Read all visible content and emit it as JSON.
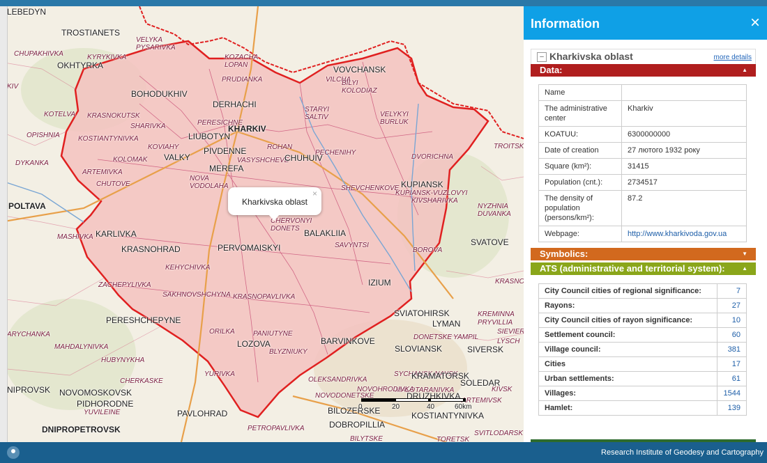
{
  "map": {
    "popup_label": "Kharkivska oblast",
    "popup_close": "×",
    "scale_labels": [
      "0",
      "20",
      "40",
      "60km"
    ],
    "place_labels": [
      {
        "text": "LEBEDYN",
        "c": "big"
      },
      {
        "text": "TROSTIANETS",
        "c": "big"
      },
      {
        "text": "VELYKA\nPYSARIVKA",
        "c": ""
      },
      {
        "text": "CHUPAKHIVKA",
        "c": ""
      },
      {
        "text": "KYRYKIVKA",
        "c": ""
      },
      {
        "text": "OKHTYRKA",
        "c": "big"
      },
      {
        "text": "KIV",
        "c": ""
      },
      {
        "text": "KOZACHA\nLOPAN",
        "c": ""
      },
      {
        "text": "VOVCHANSK",
        "c": "big"
      },
      {
        "text": "PRUDIANKA",
        "c": ""
      },
      {
        "text": "VILCHA",
        "c": ""
      },
      {
        "text": "BILYI\nKOLODIAZ",
        "c": ""
      },
      {
        "text": "BOHODUKHIV",
        "c": "big"
      },
      {
        "text": "DERHACHI",
        "c": "big"
      },
      {
        "text": "KOTELVA",
        "c": ""
      },
      {
        "text": "KRASNOKUTSK",
        "c": ""
      },
      {
        "text": "STARYI\nSALTIV",
        "c": ""
      },
      {
        "text": "VELYKYI\nBURLUK",
        "c": ""
      },
      {
        "text": "SHARIVKA",
        "c": ""
      },
      {
        "text": "PERESICHNE",
        "c": ""
      },
      {
        "text": "KHARKIV",
        "c": "cap"
      },
      {
        "text": "OPISHNIA",
        "c": ""
      },
      {
        "text": "KOSTIANTYNIVKA",
        "c": ""
      },
      {
        "text": "LIUBOTYN",
        "c": "big"
      },
      {
        "text": "KOVIAHY",
        "c": ""
      },
      {
        "text": "ROHAN",
        "c": ""
      },
      {
        "text": "PECHENIHY",
        "c": ""
      },
      {
        "text": "TROITSKE",
        "c": ""
      },
      {
        "text": "DYKANKA",
        "c": ""
      },
      {
        "text": "KOLOMAK",
        "c": ""
      },
      {
        "text": "VALKY",
        "c": "big"
      },
      {
        "text": "PIVDENNE",
        "c": "big"
      },
      {
        "text": "VASYSHCHEVE",
        "c": ""
      },
      {
        "text": "CHUHUIV",
        "c": "big"
      },
      {
        "text": "DVORICHNA",
        "c": ""
      },
      {
        "text": "MEREFA",
        "c": "big"
      },
      {
        "text": "ARTEMIVKA",
        "c": ""
      },
      {
        "text": "CHUTOVE",
        "c": ""
      },
      {
        "text": "NOVA\nVODOLAHA",
        "c": ""
      },
      {
        "text": "SHEVCHENKOVE",
        "c": ""
      },
      {
        "text": "KUPIANSK",
        "c": "big"
      },
      {
        "text": "KUPIANSK-VUZLOVYI",
        "c": ""
      },
      {
        "text": "KIVSHARIVKA",
        "c": ""
      },
      {
        "text": "POLTAVA",
        "c": "cap"
      },
      {
        "text": "NYZHNIA\nDUVANKA",
        "c": ""
      },
      {
        "text": "CHERVONYI\nDONETS",
        "c": ""
      },
      {
        "text": "BALAKLIIA",
        "c": "big"
      },
      {
        "text": "MASHIVKA",
        "c": ""
      },
      {
        "text": "KARLIVKA",
        "c": "big"
      },
      {
        "text": "SVATOVE",
        "c": "big"
      },
      {
        "text": "KRASNOHRAD",
        "c": "big"
      },
      {
        "text": "PERVOMAISKYI",
        "c": "big"
      },
      {
        "text": "SAVYNTSI",
        "c": ""
      },
      {
        "text": "BOROVA",
        "c": ""
      },
      {
        "text": "KEHYCHIVKA",
        "c": ""
      },
      {
        "text": "IZIUM",
        "c": "big"
      },
      {
        "text": "KRASNORICHENSKE",
        "c": ""
      },
      {
        "text": "ZACHEPYLIVKA",
        "c": ""
      },
      {
        "text": "SAKHNOVSHCHYNA",
        "c": ""
      },
      {
        "text": "KRASNOPAVLIVKA",
        "c": ""
      },
      {
        "text": "SVIATOHIRSK",
        "c": "big"
      },
      {
        "text": "KREMINNA",
        "c": ""
      },
      {
        "text": "PRYVILLIA",
        "c": ""
      },
      {
        "text": "PERESHCHEPYNE",
        "c": "big"
      },
      {
        "text": "LYMAN",
        "c": "big"
      },
      {
        "text": "ARYCHANKA",
        "c": ""
      },
      {
        "text": "ORILKA",
        "c": ""
      },
      {
        "text": "PANIUTYNE",
        "c": ""
      },
      {
        "text": "DONETSKE",
        "c": ""
      },
      {
        "text": "YAMPIL",
        "c": ""
      },
      {
        "text": "SIEVIER",
        "c": ""
      },
      {
        "text": "LYSCH",
        "c": ""
      },
      {
        "text": "MAHDALYNIVKA",
        "c": ""
      },
      {
        "text": "LOZOVA",
        "c": "big"
      },
      {
        "text": "BARVINKOVE",
        "c": "big"
      },
      {
        "text": "SIVERSK",
        "c": "big"
      },
      {
        "text": "BLYZNIUKY",
        "c": ""
      },
      {
        "text": "SLOVIANSK",
        "c": "big"
      },
      {
        "text": "HUBYNYKHA",
        "c": ""
      },
      {
        "text": "YURIVKA",
        "c": ""
      },
      {
        "text": "SYCHANSK-NAYSK",
        "c": ""
      },
      {
        "text": "KRAMATORSK",
        "c": "big"
      },
      {
        "text": "CHERKASKE",
        "c": ""
      },
      {
        "text": "OLEKSANDRIVKA",
        "c": ""
      },
      {
        "text": "SOLEDAR",
        "c": "big"
      },
      {
        "text": "NIPROVSK",
        "c": "big"
      },
      {
        "text": "NOVOMOSKOVSK",
        "c": "big"
      },
      {
        "text": "NOVODONETSKE",
        "c": ""
      },
      {
        "text": "MALOTARANIVKA",
        "c": ""
      },
      {
        "text": "KIVSK",
        "c": ""
      },
      {
        "text": "PIDHORODNE",
        "c": "big"
      },
      {
        "text": "DRUZHKIVKA",
        "c": "big"
      },
      {
        "text": "ARTEMIVSK",
        "c": ""
      },
      {
        "text": "YUVILEINE",
        "c": ""
      },
      {
        "text": "PAVLOHRAD",
        "c": "big"
      },
      {
        "text": "BILOZERSKE",
        "c": "big"
      },
      {
        "text": "KOSTIANTYNIVKA",
        "c": "big"
      },
      {
        "text": "DNIPROPETROVSK",
        "c": "cap"
      },
      {
        "text": "PETROPAVLIVKA",
        "c": ""
      },
      {
        "text": "DOBROPILLIA",
        "c": "big"
      },
      {
        "text": "BILYTSKE",
        "c": ""
      },
      {
        "text": "TORETSK",
        "c": ""
      },
      {
        "text": "SVITLODARSK",
        "c": ""
      },
      {
        "text": "NOVOHRODIVKA",
        "c": ""
      }
    ]
  },
  "panel": {
    "title": "Information",
    "close": "×",
    "oblast": "Kharkivska oblast",
    "collapse_symbol": "–",
    "more_details": "more details",
    "sections": {
      "data": "Data:",
      "symbolics": "Symbolics:",
      "ats": "ATS (administrative and territorial system):"
    },
    "data_rows": [
      {
        "key": "Name",
        "value": ""
      },
      {
        "key": "The administrative center",
        "value": "Kharkiv"
      },
      {
        "key": "KOATUU:",
        "value": "6300000000"
      },
      {
        "key": "Date of creation",
        "value": "27 лютого 1932 року"
      },
      {
        "key": "Square (km²):",
        "value": "31415"
      },
      {
        "key": "Population (cnt.):",
        "value": "2734517"
      },
      {
        "key": "The density of population (persons/km²):",
        "value": "87.2"
      },
      {
        "key": "Webpage:",
        "value": "http://www.kharkivoda.gov.ua",
        "link": true
      }
    ],
    "ats_rows": [
      {
        "key": "City Council cities of regional significance:",
        "value": "7"
      },
      {
        "key": "Rayons:",
        "value": "27"
      },
      {
        "key": "City Council cities of rayon significance:",
        "value": "10"
      },
      {
        "key": "Settlement council:",
        "value": "60"
      },
      {
        "key": "Village council:",
        "value": "381"
      },
      {
        "key": "Cities",
        "value": "17"
      },
      {
        "key": "Urban settlements:",
        "value": "61"
      },
      {
        "key": "Villages:",
        "value": "1544"
      },
      {
        "key": "Hamlet:",
        "value": "139"
      }
    ]
  },
  "footer": {
    "credit": "Research Institute of Geodesy and Cartography"
  },
  "colors": {
    "header": "#0fa0e6",
    "data_section": "#b01e1e",
    "symbolics_section": "#d2691e",
    "ats_section": "#8aa61a",
    "oblast_fill": "#f3c2c0",
    "border": "#e02020",
    "footer": "#1a5f8e"
  }
}
